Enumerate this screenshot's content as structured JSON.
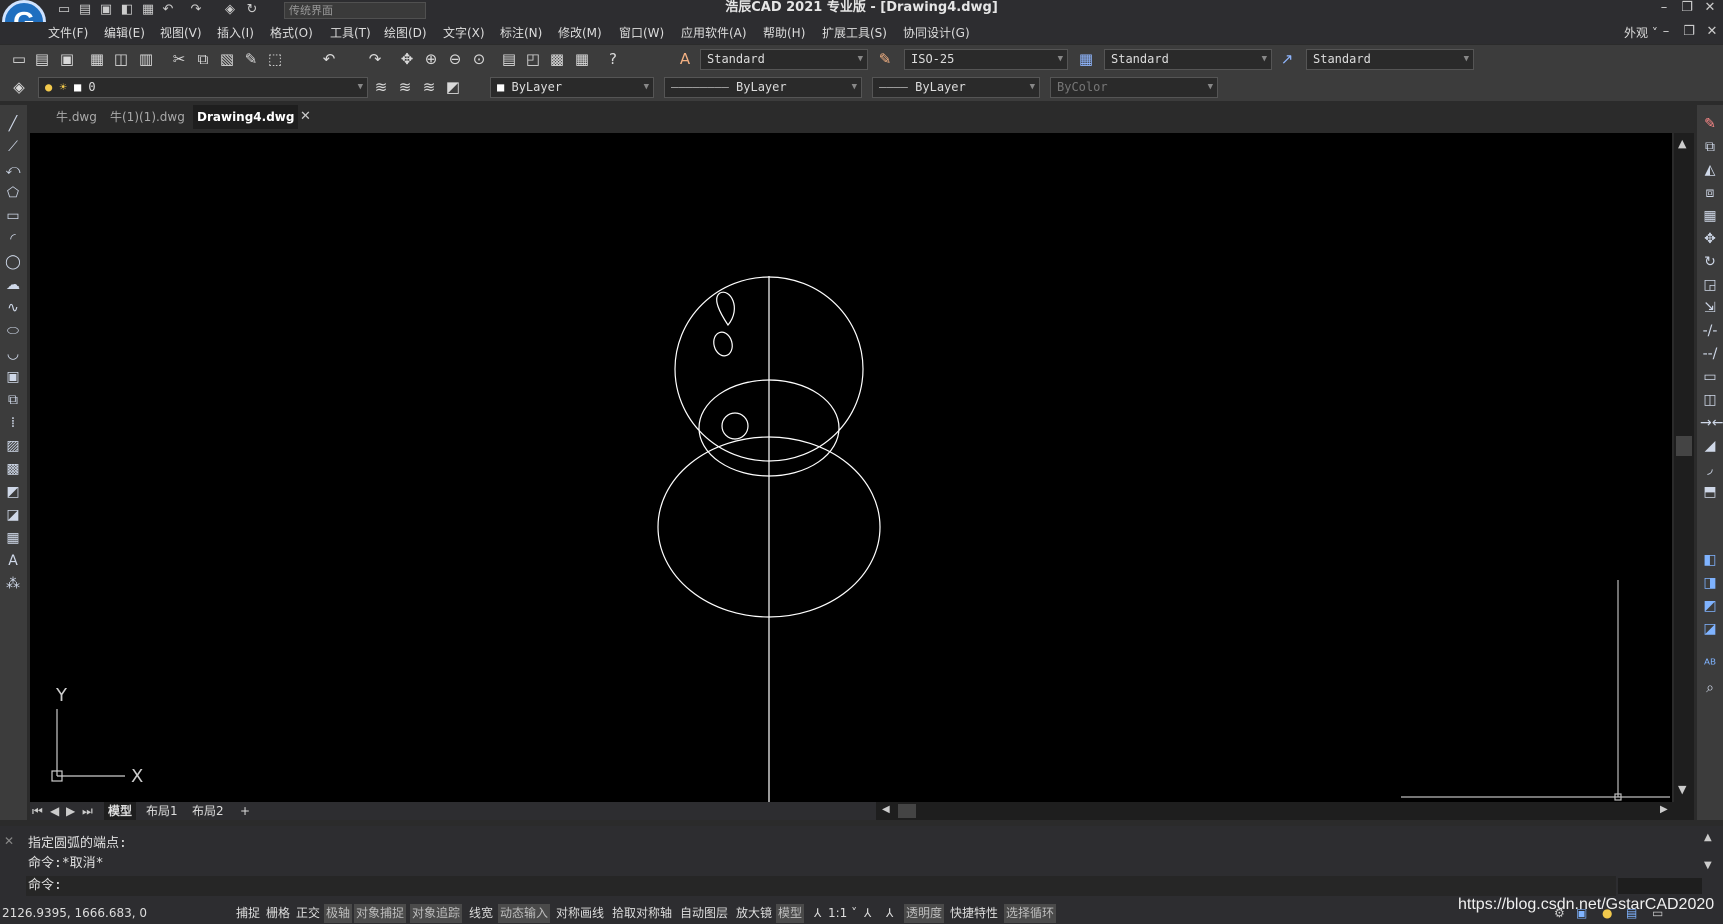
{
  "title_bar": {
    "app_title": "浩辰CAD 2021 专业版 - [Drawing4.dwg]",
    "workspace": "传统界面",
    "logo": "G",
    "icons": [
      "new-icon",
      "open-icon",
      "save-icon",
      "saveas-icon",
      "print-icon",
      "undo-icon",
      "redo-icon",
      "plot-icon",
      "refresh-icon"
    ]
  },
  "menus": [
    "文件(F)",
    "编辑(E)",
    "视图(V)",
    "插入(I)",
    "格式(O)",
    "工具(T)",
    "绘图(D)",
    "文字(X)",
    "标注(N)",
    "修改(M)",
    "窗口(W)",
    "应用软件(A)",
    "帮助(H)",
    "扩展工具(S)",
    "协同设计(G)"
  ],
  "appearance_menu": "外观",
  "toolbar1": {
    "text_style": "Standard",
    "dim_style": "ISO-25",
    "table_style": "Standard",
    "multileader_style": "Standard"
  },
  "toolbar2": {
    "layer": "0",
    "color": "ByLayer",
    "linetype": "ByLayer",
    "lineweight": "ByLayer",
    "plot_style": "ByColor"
  },
  "file_tabs": [
    {
      "label": "牛.dwg",
      "active": false
    },
    {
      "label": "牛(1)(1).dwg",
      "active": false
    },
    {
      "label": "Drawing4.dwg",
      "active": true
    }
  ],
  "ucs": {
    "x_label": "X",
    "y_label": "Y"
  },
  "layout_tabs": [
    "模型",
    "布局1",
    "布局2",
    "+"
  ],
  "command": {
    "history": [
      "指定圆弧的端点:",
      "命令:*取消*"
    ],
    "prompt": "命令:"
  },
  "status": {
    "coords": "2126.9395, 1666.683, 0",
    "toggles": [
      {
        "label": "捕捉",
        "on": false
      },
      {
        "label": "栅格",
        "on": false
      },
      {
        "label": "正交",
        "on": false
      },
      {
        "label": "极轴",
        "on": true
      },
      {
        "label": "对象捕捉",
        "on": true
      },
      {
        "label": "对象追踪",
        "on": true
      },
      {
        "label": "线宽",
        "on": false
      },
      {
        "label": "动态输入",
        "on": true
      },
      {
        "label": "对称画线",
        "on": false
      },
      {
        "label": "拾取对称轴",
        "on": false
      },
      {
        "label": "自动图层",
        "on": false
      },
      {
        "label": "放大镜",
        "on": false
      },
      {
        "label": "模型",
        "on": true
      }
    ],
    "scale": "1:1",
    "toggles2": [
      {
        "label": "透明度",
        "on": true
      },
      {
        "label": "快捷特性",
        "on": false
      },
      {
        "label": "选择循环",
        "on": true
      }
    ]
  },
  "watermark": "https://blog.csdn.net/GstarCAD2020"
}
